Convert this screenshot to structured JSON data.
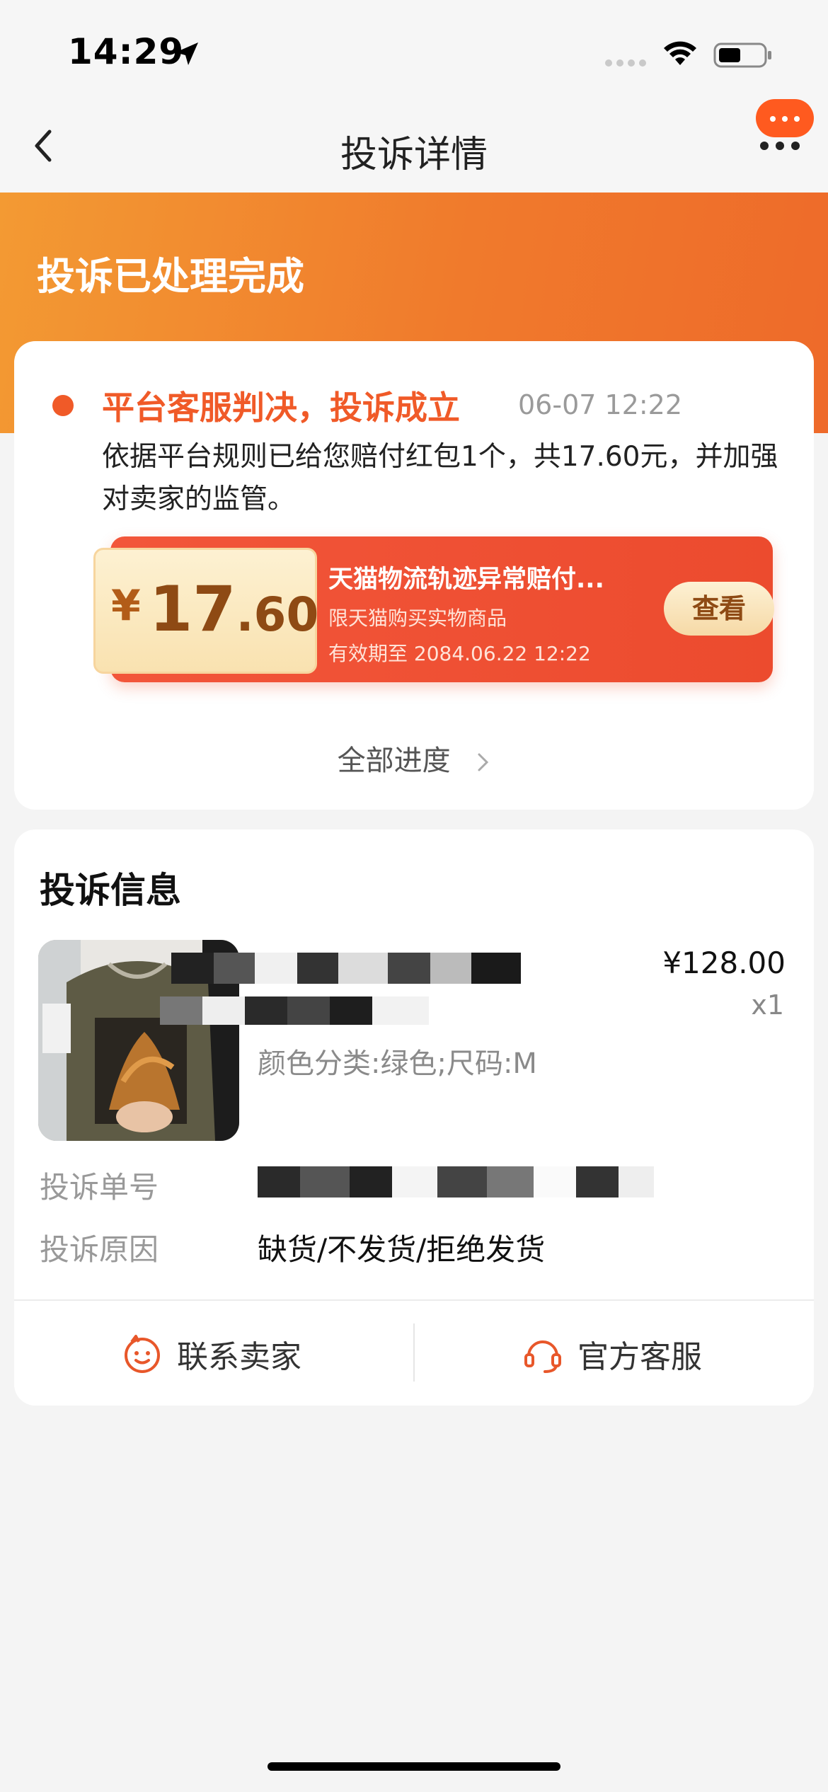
{
  "status_bar": {
    "time": "14:29",
    "icons": [
      "location-arrow-icon",
      "signal-icon",
      "wifi-icon",
      "battery-icon"
    ]
  },
  "nav": {
    "title": "投诉详情",
    "back_icon": "chevron-left-icon",
    "more_icon": "more-dots-icon"
  },
  "header": {
    "status_title": "投诉已处理完成",
    "gradient_from": "#f39a33",
    "gradient_to": "#ee6a2a"
  },
  "result": {
    "title": "平台客服判决，投诉成立",
    "time": "06-07 12:22",
    "description": "依据平台规则已给您赔付红包1个，共17.60元，并加强对卖家的监管。",
    "accent_color": "#f05a28"
  },
  "coupon": {
    "currency": "¥",
    "amount_int": "17",
    "amount_dec": ".60",
    "name": "天猫物流轨迹异常赔付...",
    "scope": "限天猫购买实物商品",
    "expiry": "有效期至 2084.06.22 12:22",
    "button_label": "查看"
  },
  "progress_link": {
    "label": "全部进度"
  },
  "info": {
    "title": "投诉信息",
    "product": {
      "price": "¥128.00",
      "quantity": "x1",
      "spec": "颜色分类:绿色;尺码:M",
      "name_redacted": true
    },
    "rows": [
      {
        "label": "投诉单号",
        "value_redacted": true
      },
      {
        "label": "投诉原因",
        "value": "缺货/不发货/拒绝发货"
      }
    ]
  },
  "actions": {
    "contact_seller": "联系卖家",
    "official_service": "官方客服",
    "icon_color": "#e8572a"
  }
}
